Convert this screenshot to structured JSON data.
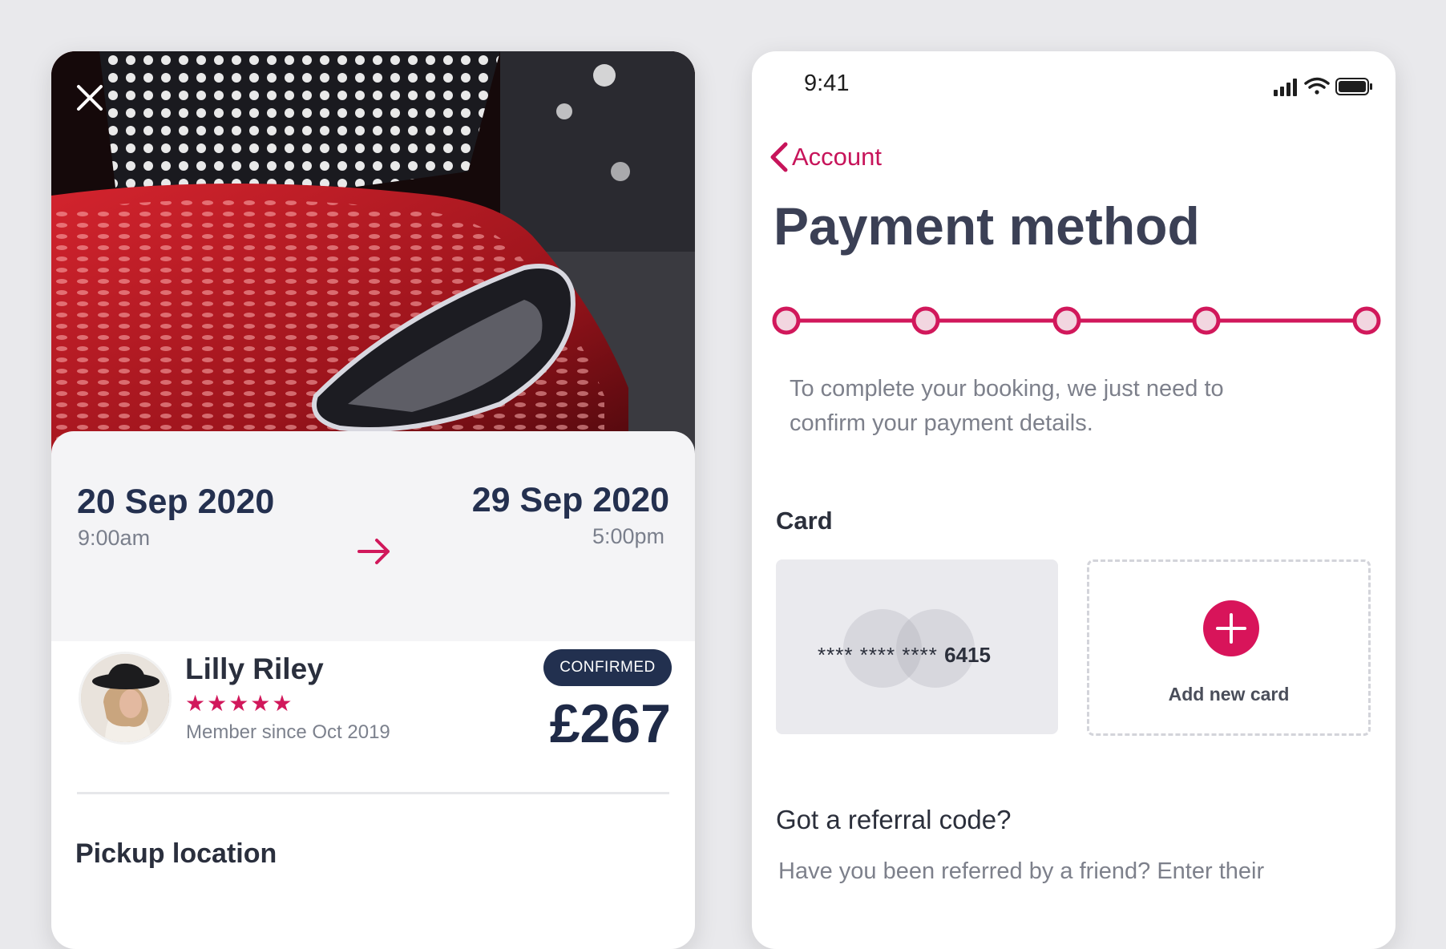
{
  "colors": {
    "accent": "#d1185b",
    "navy": "#22304f",
    "background": "#e9e9ec",
    "panel": "#f4f4f6"
  },
  "booking": {
    "close_icon": "close-icon",
    "start_date": "20 Sep 2020",
    "start_time": "9:00am",
    "arrow_icon": "arrow-right-icon",
    "end_date": "29 Sep 2020",
    "end_time": "5:00pm",
    "host": {
      "name": "Lilly Riley",
      "rating_stars": "★★★★★",
      "rating": 5,
      "member_since": "Member since Oct 2019"
    },
    "status_badge": "CONFIRMED",
    "price": "£267",
    "pickup_title": "Pickup location"
  },
  "payment": {
    "status_bar": {
      "time": "9:41",
      "icons": [
        "signal-icon",
        "wifi-icon",
        "battery-icon"
      ]
    },
    "back_label": "Account",
    "title": "Payment method",
    "steps": 5,
    "description": "To complete your booking, we just need to confirm your payment details.",
    "card_section_label": "Card",
    "saved_card": {
      "masked": "**** **** ****",
      "last4": "6415"
    },
    "add_card_label": "Add new card",
    "referral_title": "Got a referral code?",
    "referral_desc": "Have you been referred by a friend? Enter their"
  }
}
